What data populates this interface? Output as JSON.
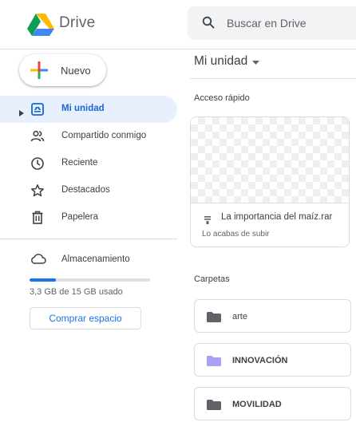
{
  "header": {
    "app_title": "Drive",
    "search_placeholder": "Buscar en Drive"
  },
  "sidebar": {
    "new_label": "Nuevo",
    "items": [
      {
        "label": "Mi unidad",
        "icon": "drive-icon",
        "active": true
      },
      {
        "label": "Compartido conmigo",
        "icon": "people-icon",
        "active": false
      },
      {
        "label": "Reciente",
        "icon": "clock-icon",
        "active": false
      },
      {
        "label": "Destacados",
        "icon": "star-icon",
        "active": false
      },
      {
        "label": "Papelera",
        "icon": "trash-icon",
        "active": false
      }
    ],
    "storage": {
      "label": "Almacenamiento",
      "usage_text": "3,3 GB de 15 GB usado",
      "used_fraction": 0.22,
      "buy_label": "Comprar espacio"
    }
  },
  "main": {
    "title": "Mi unidad",
    "quick_access": {
      "label": "Acceso rápido",
      "file_name": "La importancia del maíz.rar",
      "subtitle": "Lo acabas de subir"
    },
    "folders_label": "Carpetas",
    "folders": [
      {
        "name": "arte",
        "color": "#5f6368"
      },
      {
        "name": "INNOVACIÓN",
        "color": "#a8a2f4"
      },
      {
        "name": "MOVILIDAD",
        "color": "#5f6368"
      }
    ]
  },
  "colors": {
    "accent": "#1a73e8",
    "active_bg": "#e8f0fe",
    "active_text": "#1967d2"
  }
}
